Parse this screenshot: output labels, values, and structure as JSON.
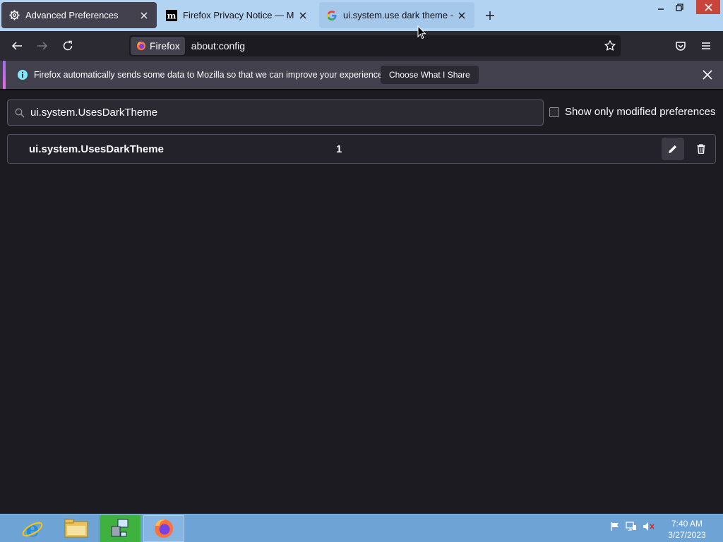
{
  "tabs": [
    {
      "title": "Advanced Preferences",
      "favicon": "gear-icon"
    },
    {
      "title": "Firefox Privacy Notice — Mozilla",
      "favicon": "mozilla-m-icon"
    },
    {
      "title": "ui.system.use dark theme - Go",
      "favicon": "google-g-icon"
    }
  ],
  "navbar": {
    "identity_label": "Firefox",
    "url": "about:config"
  },
  "notice": {
    "text": "Firefox automatically sends some data to Mozilla so that we can improve your experience.",
    "button_label": "Choose What I Share"
  },
  "config": {
    "search_value": "ui.system.UsesDarkTheme",
    "modified_only_label": "Show only modified preferences",
    "modified_only_checked": false,
    "pref": {
      "name": "ui.system.UsesDarkTheme",
      "value": "1"
    }
  },
  "taskbar": {
    "time": "7:40 AM",
    "date": "3/27/2023"
  },
  "colors": {
    "tabstrip": "#b2d3f2",
    "content_bg": "#1c1b22",
    "taskbar": "#6ea3d6"
  }
}
